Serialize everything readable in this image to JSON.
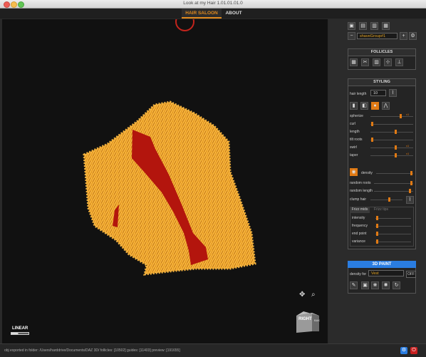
{
  "window": {
    "title": "Look at my Hair 1.01.01.01.0"
  },
  "tabs": [
    {
      "label": "HAIR SALOON"
    },
    {
      "label": "ABOUT"
    }
  ],
  "viewport": {
    "view_label": "LINEAR",
    "cube_face_front": "RIGHT",
    "cube_face_side": "BAK"
  },
  "group": {
    "selected": "shaveGroup#1"
  },
  "follicles": {
    "title": "FOLLICLES"
  },
  "styling": {
    "title": "STYLING",
    "hair_length_label": "hair length",
    "hair_length_value": "10",
    "sliders": [
      {
        "label": "spherize",
        "value": 0.72,
        "marker": "x1"
      },
      {
        "label": "curl",
        "value": 0.02,
        "marker": ""
      },
      {
        "label": "length",
        "value": 0.6,
        "marker": ""
      },
      {
        "label": "tilt roots",
        "value": 0.02,
        "marker": ""
      },
      {
        "label": "swirl",
        "value": 0.6,
        "marker": "x1"
      },
      {
        "label": "taper",
        "value": 0.6,
        "marker": "x1"
      }
    ],
    "density_label": "density",
    "density_value": 0.98,
    "random_roots_label": "random roots",
    "random_roots_value": 0.98,
    "random_length_label": "random length",
    "random_length_value": 0.95,
    "clump_label": "clump hair",
    "clump_value": 0.6,
    "frizz_tabs": [
      {
        "label": "Frizz mids"
      },
      {
        "label": "Frizz tips"
      }
    ],
    "frizz_sliders": [
      {
        "label": "intensity",
        "value": 0.02
      },
      {
        "label": "frequency",
        "value": 0.02
      },
      {
        "label": "end point",
        "value": 0.02
      },
      {
        "label": "variance",
        "value": 0.02
      }
    ]
  },
  "paint": {
    "title": "3D PAINT",
    "density_for_label": "density for",
    "density_for_value": "Vest",
    "toggle": "OFF"
  },
  "status": {
    "text": "obj exported in folder: /Users/harddrive/Documents/DAZ 3D/  follicles: [10502]  guides: [11403]  preview: [191655]"
  },
  "colors": {
    "accent": "#e08a1e",
    "hair": "#f0a72a",
    "paint_red": "#b3150d",
    "blue": "#2a7de1"
  }
}
